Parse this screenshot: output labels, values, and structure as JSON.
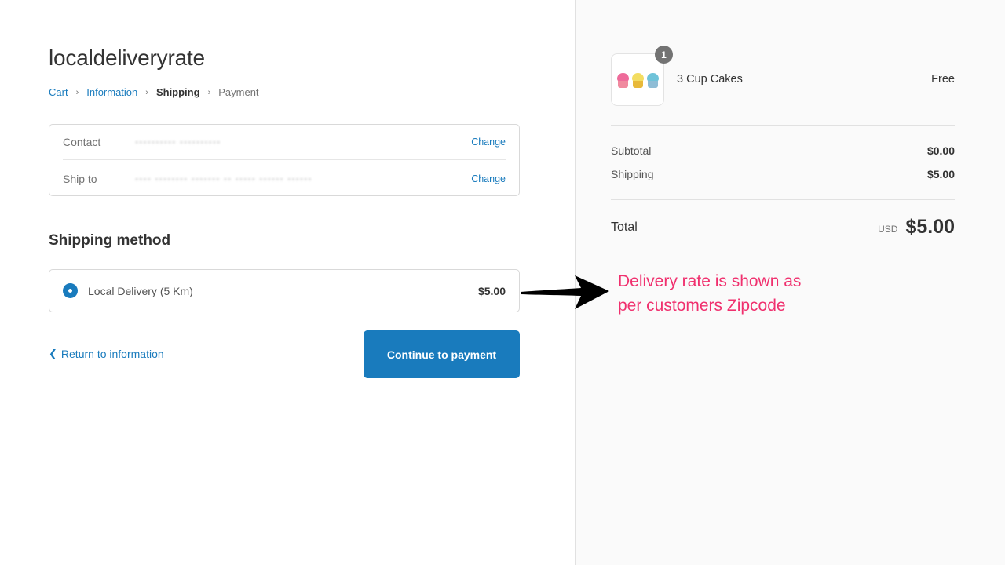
{
  "shop": {
    "title": "localdeliveryrate"
  },
  "breadcrumb": [
    {
      "label": "Cart",
      "state": "link"
    },
    {
      "label": "Information",
      "state": "link"
    },
    {
      "label": "Shipping",
      "state": "current"
    },
    {
      "label": "Payment",
      "state": "future"
    }
  ],
  "breadcrumb_separator": "›",
  "review": {
    "contact": {
      "label": "Contact",
      "value": "▪▪▪▪▪▪▪▪▪▪ ▪▪▪▪▪▪▪▪▪▪",
      "change_label": "Change"
    },
    "ship_to": {
      "label": "Ship to",
      "value": "▪▪▪▪ ▪▪▪▪▪▪▪▪ ▪▪▪▪▪▪▪ ▪▪ ▪▪▪▪▪ ▪▪▪▪▪▪ ▪▪▪▪▪▪",
      "change_label": "Change"
    }
  },
  "shipping_method": {
    "title": "Shipping method",
    "options": [
      {
        "label": "Local Delivery (5 Km)",
        "price": "$5.00",
        "selected": true
      }
    ]
  },
  "navigation": {
    "return_label": "Return to information",
    "return_icon": "chevron-left-icon",
    "continue_label": "Continue to payment"
  },
  "annotation": {
    "line1": "Delivery rate is shown as",
    "line2": "per customers Zipcode",
    "color": "#f0306e"
  },
  "order_summary": {
    "items": [
      {
        "name": "3 Cup Cakes",
        "price": "Free",
        "quantity": "1",
        "image": "cupcakes-thumbnail"
      }
    ],
    "subtotal_label": "Subtotal",
    "subtotal_value": "$0.00",
    "shipping_label": "Shipping",
    "shipping_value": "$5.00",
    "total_label": "Total",
    "currency": "USD",
    "total_value": "$5.00"
  },
  "colors": {
    "accent": "#197bbd",
    "sidebar_bg": "#fafafa",
    "annotation": "#f0306e"
  }
}
